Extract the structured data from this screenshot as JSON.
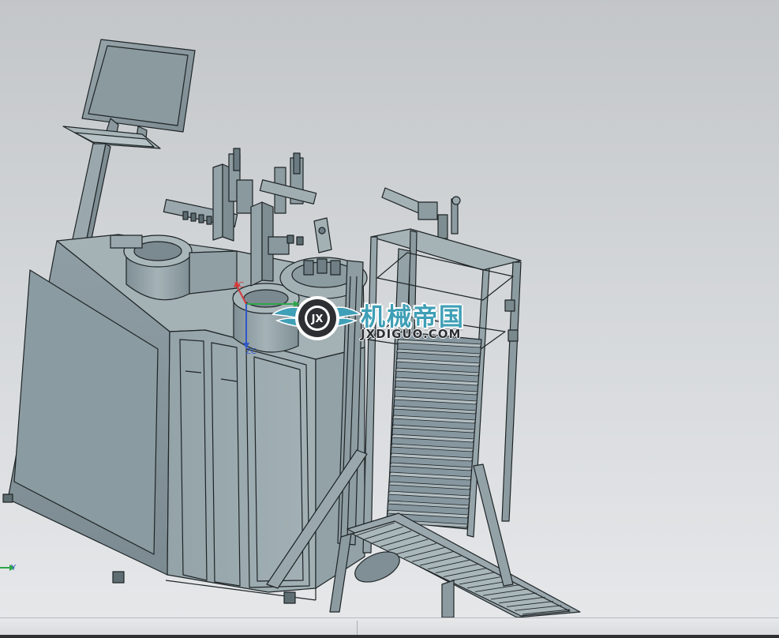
{
  "viewport": {
    "background_top": "#c3c6c9",
    "background_bottom": "#e5e7e9",
    "model_color": "#8a9aa0",
    "edge_color": "#1e2426"
  },
  "csys": {
    "work_x_label": "XC",
    "work_z_label": "ZC",
    "abs_y_label": "Y",
    "x_color": "#d23a3a",
    "y_color": "#2fa64a",
    "z_color": "#2f57c8"
  },
  "watermark": {
    "title": "机械帝国",
    "url": "JXDIGUO.COM",
    "badge_text": "JX",
    "brand_color": "#3f9fb6"
  }
}
